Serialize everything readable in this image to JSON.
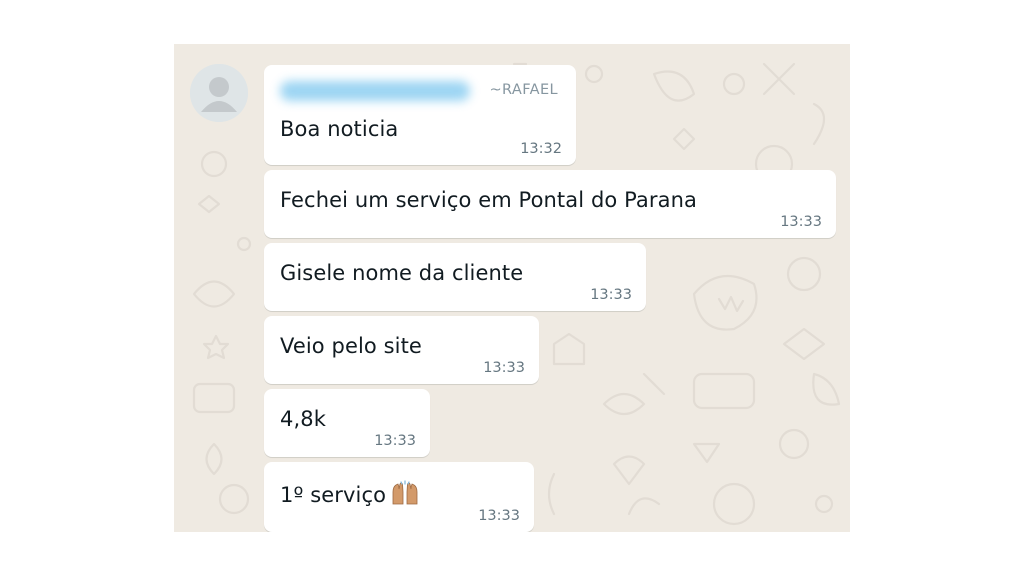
{
  "chat": {
    "group_sender": {
      "name": "~RAFAEL"
    },
    "messages": [
      {
        "text": "Boa noticia",
        "time": "13:32"
      },
      {
        "text": "Fechei um serviço em Pontal do Parana",
        "time": "13:33"
      },
      {
        "text": "Gisele nome da cliente",
        "time": "13:33"
      },
      {
        "text": "Veio pelo site",
        "time": "13:33"
      },
      {
        "text": "4,8k",
        "time": "13:33"
      },
      {
        "text": "1º serviço",
        "time": "13:33",
        "emoji": "raising-hands-emoji"
      }
    ]
  },
  "colors": {
    "wallpaper": "#efeae2",
    "bubble": "#ffffff",
    "text": "#111b21",
    "timestamp": "#667781",
    "sender_name": "#8696a0"
  }
}
